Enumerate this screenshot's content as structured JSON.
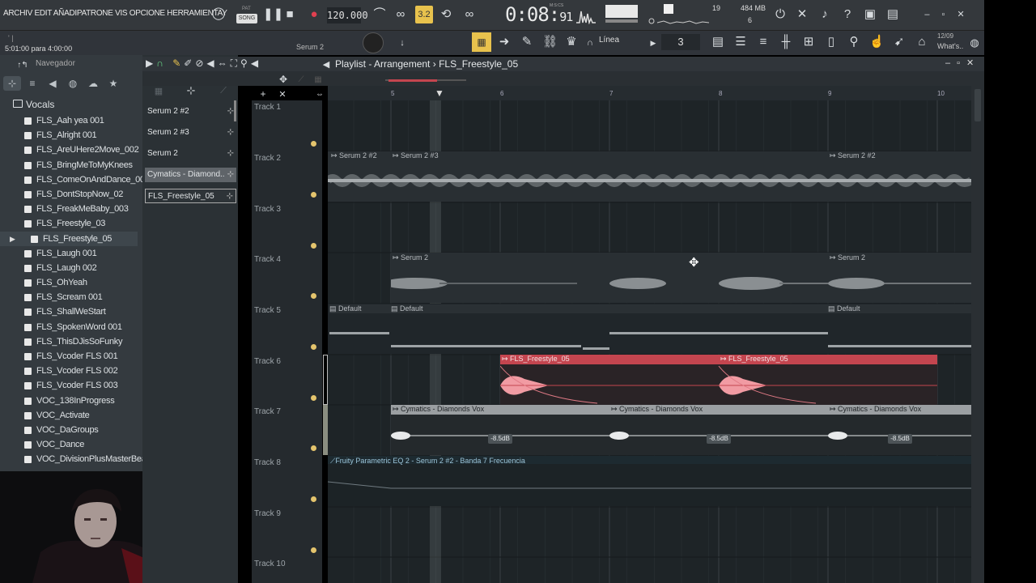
{
  "app": {
    "menu": "ARCHIV EDIT AÑADIPATRONE VIS OPCIONE HERRAMIENTAY",
    "pat_label": "PAT",
    "song_label": "SONG",
    "tempo": "120.000",
    "time_main": "0:08",
    "time_ms": "91",
    "time_unit": "M:S:CS",
    "cpu": "19",
    "memory": "484 MB",
    "memory_sub": "6",
    "accent": "#e8c24d"
  },
  "toolbar2": {
    "hint_top": "' |",
    "hint": "5:01:00 para 4:00:00",
    "serum_label": "Serum 2",
    "snap": "Línea",
    "pattern_number": "3",
    "news_date": "12/09",
    "news_label": "What's.."
  },
  "browser": {
    "title": "Navegador",
    "folder": "Vocals",
    "files": [
      "FLS_Aah yea 001",
      "FLS_Alright 001",
      "FLS_AreUHere2Move_002",
      "FLS_BringMeToMyKnees",
      "FLS_ComeOnAndDance_001",
      "FLS_DontStopNow_02",
      "FLS_FreakMeBaby_003",
      "FLS_Freestyle_03",
      "FLS_Freestyle_05",
      "FLS_Laugh 001",
      "FLS_Laugh 002",
      "FLS_OhYeah",
      "FLS_Scream 001",
      "FLS_ShallWeStart",
      "FLS_SpokenWord 001",
      "FLS_ThisDJisSoFunky",
      "FLS_Vcoder FLS 001",
      "FLS_Vcoder FLS 002",
      "FLS_Vcoder FLS 003",
      "VOC_138InProgress",
      "VOC_Activate",
      "VOC_DaGroups",
      "VOC_Dance",
      "VOC_DivisionPlusMasterBeat"
    ],
    "selected_index": 8
  },
  "picker": {
    "items": [
      "Serum 2 #2",
      "Serum 2 #3",
      "Serum 2",
      "Cymatics - Diamond..",
      "FLS_Freestyle_05"
    ]
  },
  "playlist": {
    "title": "Playlist - Arrangement",
    "arrangement": "FLS_Freestyle_05",
    "bars": [
      "5",
      "6",
      "7",
      "8",
      "9",
      "10"
    ],
    "tracks": [
      "Track 1",
      "Track 2",
      "Track 3",
      "Track 4",
      "Track 5",
      "Track 6",
      "Track 7",
      "Track 8",
      "Track 9",
      "Track 10"
    ],
    "clips": {
      "t2_a": "Serum 2 #2",
      "t2_b": "Serum 2 #3",
      "t2_c": "Serum 2 #2",
      "t4_a": "Serum 2",
      "t4_b": "Serum 2",
      "t5_a": "Default",
      "t5_b": "Default",
      "t5_c": "Default",
      "t6_a": "FLS_Freestyle_05",
      "t6_b": "FLS_Freestyle_05",
      "t7_a": "Cymatics - Diamonds Vox",
      "t7_b": "Cymatics - Diamonds Vox",
      "t7_c": "Cymatics - Diamonds Vox",
      "db": "-8.5dB",
      "automation": "Fruity Parametric EQ 2 - Serum 2 #2 - Banda 7 Frecuencia"
    },
    "colors": {
      "audio_clip": "#c4454f",
      "audio_wave": "#f19ba3",
      "sample_clip": "#9b9fa2"
    }
  }
}
